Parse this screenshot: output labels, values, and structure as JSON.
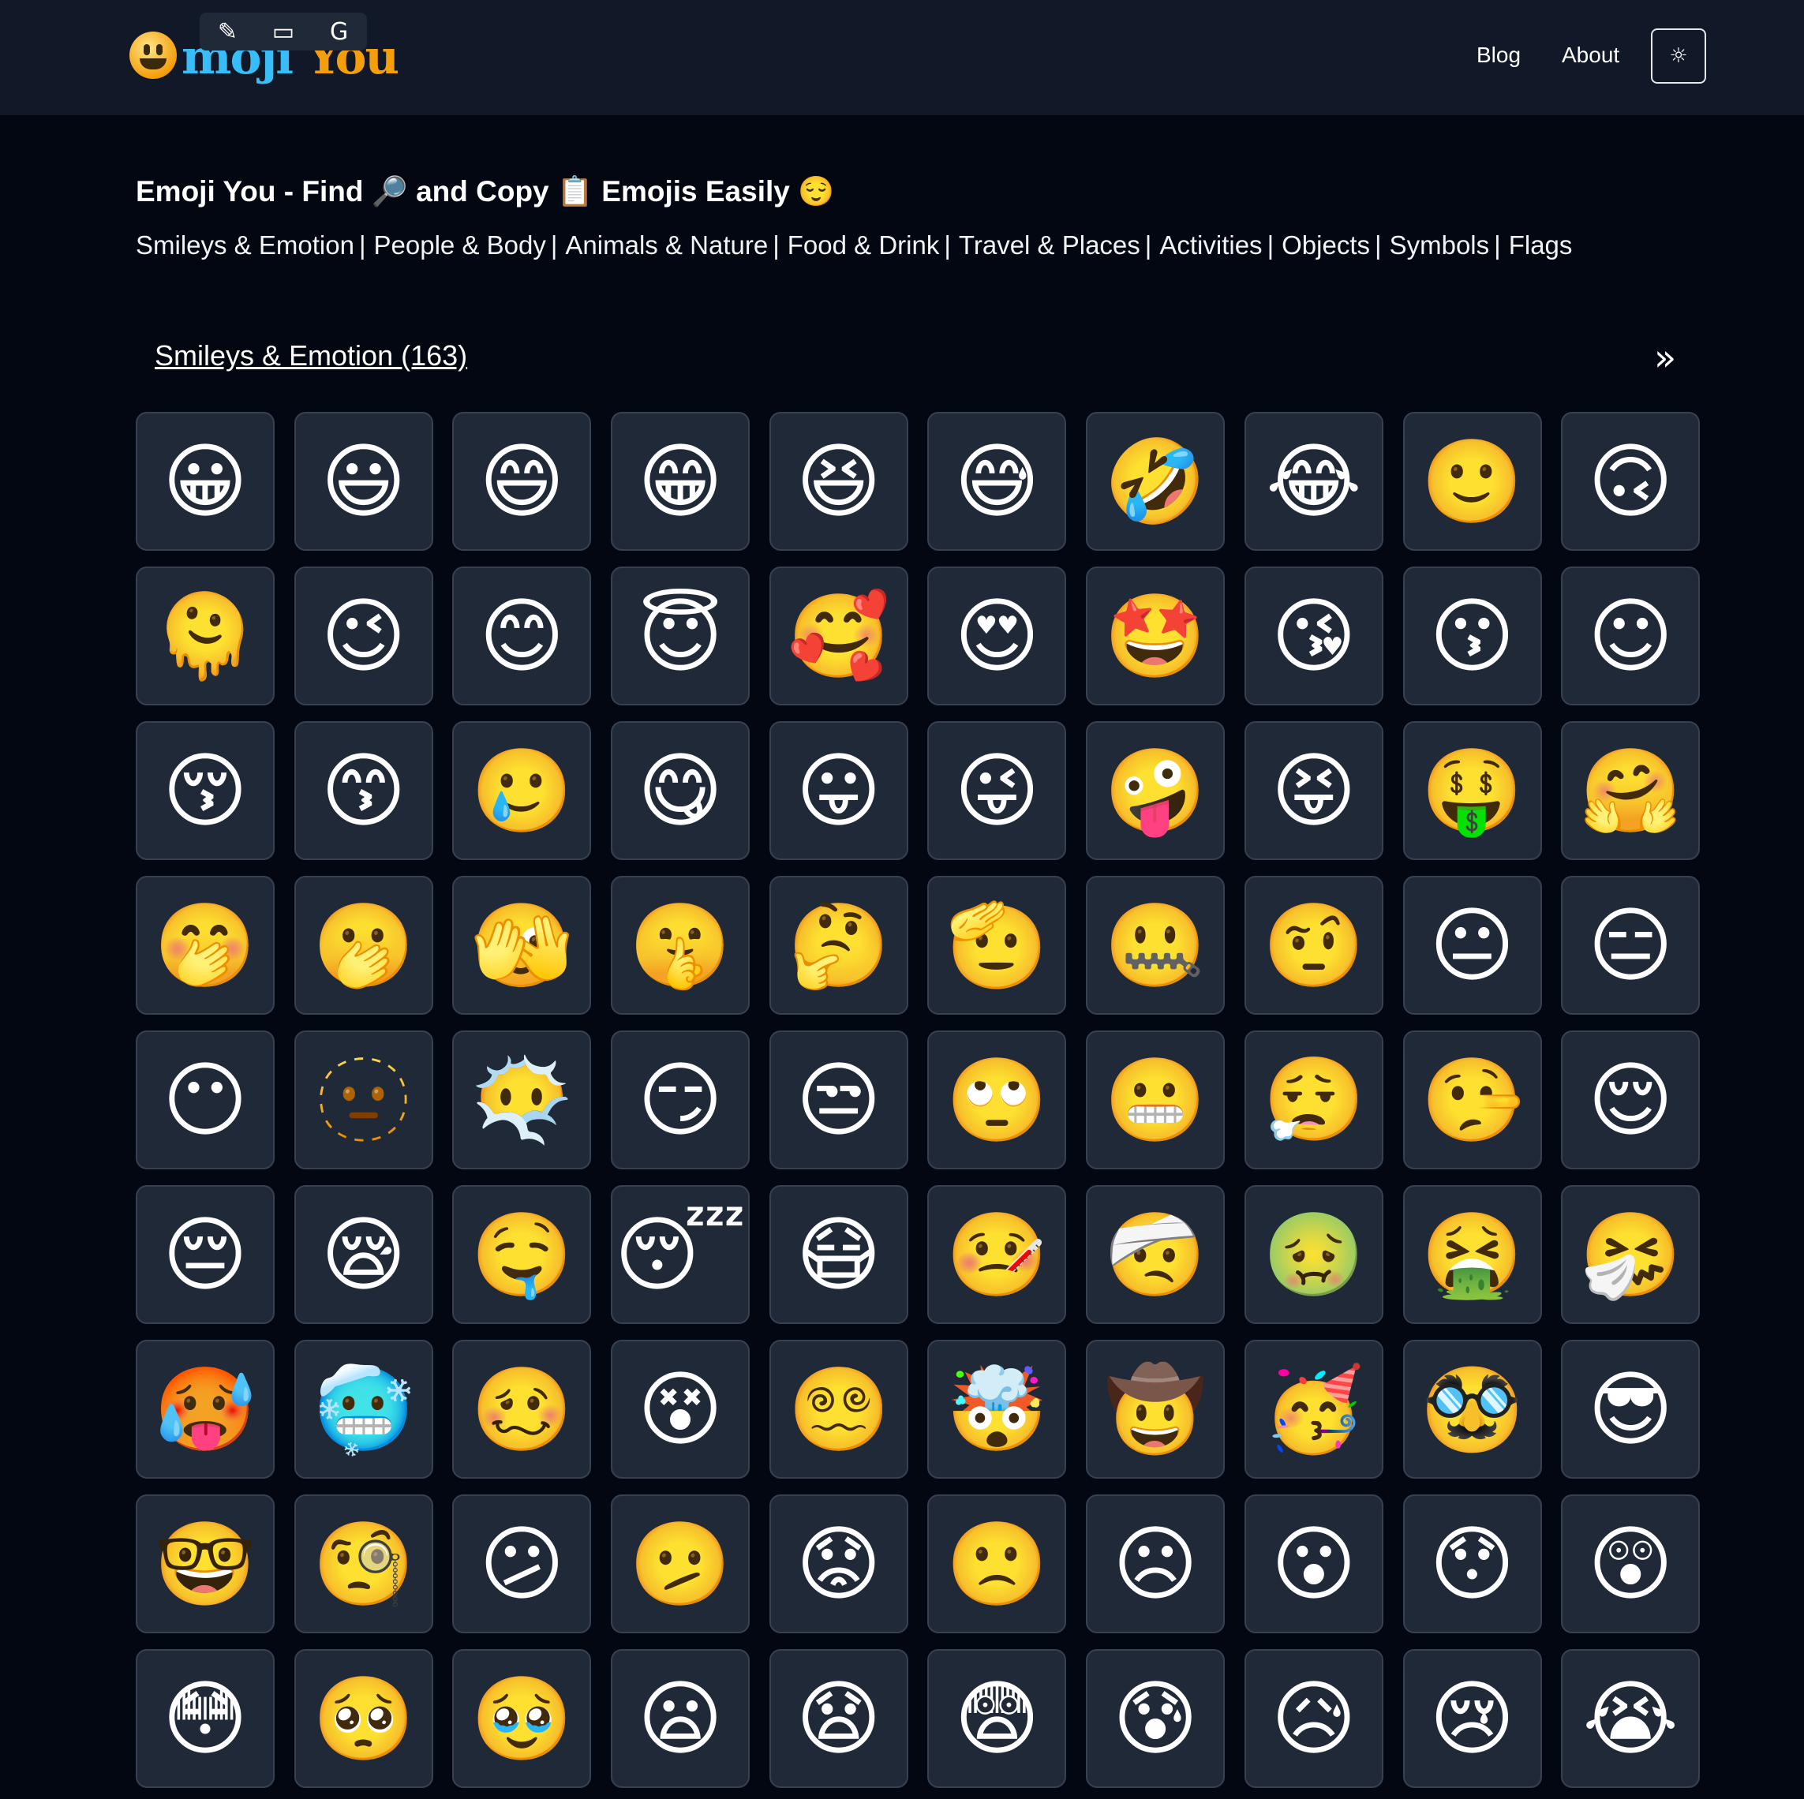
{
  "header": {
    "logo_word_1": "moji",
    "logo_word_2": "You",
    "extension_toolbar": [
      "✎",
      "▭",
      "G"
    ],
    "nav": {
      "blog": "Blog",
      "about": "About"
    },
    "theme_icon": "☼"
  },
  "hero": {
    "title": "Emoji You - Find 🔎 and Copy 📋 Emojis Easily 😌"
  },
  "categories": [
    "Smileys & Emotion",
    "People & Body",
    "Animals & Nature",
    "Food & Drink",
    "Travel & Places",
    "Activities",
    "Objects",
    "Symbols",
    "Flags"
  ],
  "section": {
    "title": "Smileys & Emotion (163)",
    "next_icon": "»"
  },
  "emojis": [
    "😀",
    "😃",
    "😄",
    "😁",
    "😆",
    "😅",
    "🤣",
    "😂",
    "🙂",
    "🙃",
    "🫠",
    "😉",
    "😊",
    "😇",
    "🥰",
    "😍",
    "🤩",
    "😘",
    "😗",
    "☺",
    "😚",
    "😙",
    "🥲",
    "😋",
    "😛",
    "😜",
    "🤪",
    "😝",
    "🤑",
    "🤗",
    "🤭",
    "🫢",
    "🫣",
    "🤫",
    "🤔",
    "🫡",
    "🤐",
    "🤨",
    "😐",
    "😑",
    "😶",
    "🫥",
    "😶‍🌫️",
    "😏",
    "😒",
    "🙄",
    "😬",
    "😮‍💨",
    "🤥",
    "😌",
    "😔",
    "😪",
    "🤤",
    "😴",
    "😷",
    "🤒",
    "🤕",
    "🤢",
    "🤮",
    "🤧",
    "🥵",
    "🥶",
    "🥴",
    "😵",
    "😵‍💫",
    "🤯",
    "🤠",
    "🥳",
    "🥸",
    "😎",
    "🤓",
    "🧐",
    "😕",
    "🫤",
    "😟",
    "🙁",
    "☹",
    "😮",
    "😯",
    "😲",
    "😳",
    "🥺",
    "🥹",
    "😦",
    "😧",
    "😨",
    "😰",
    "😥",
    "😢",
    "😭"
  ]
}
